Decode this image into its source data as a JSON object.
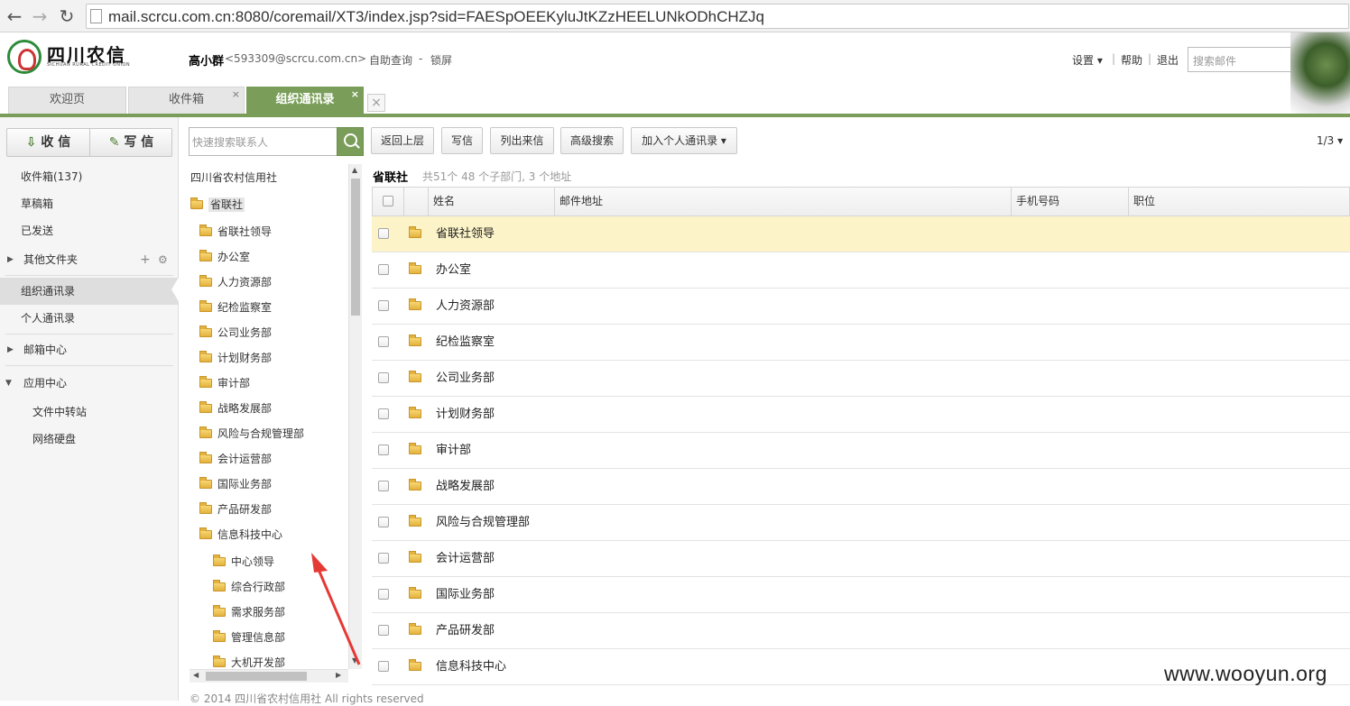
{
  "browser": {
    "url": "mail.scrcu.com.cn:8080/coremail/XT3/index.jsp?sid=FAESpOEEKyluJtKZzHEELUNkODhCHZJq"
  },
  "header": {
    "logo_name": "四川农信",
    "logo_pinyin": "SICHUAN RURAL CREDIT UNION",
    "user_name": "高小群",
    "user_email": "<593309@scrcu.com.cn>",
    "self_query": "自助查询",
    "dash": "-",
    "lock_screen": "锁屏",
    "settings": "设置",
    "settings_caret": "▾",
    "bar1": "|",
    "help": "帮助",
    "bar2": "|",
    "logout": "退出",
    "search_placeholder": "搜索邮件"
  },
  "tabs": [
    {
      "label": "欢迎页"
    },
    {
      "label": "收件箱",
      "close": "×"
    },
    {
      "label": "组织通讯录",
      "close": "×"
    }
  ],
  "tab_close_all": "×",
  "compose": {
    "receive_label": "收 信",
    "write_label": "写 信"
  },
  "nav": {
    "inbox": "收件箱(137)",
    "drafts": "草稿箱",
    "sent": "已发送",
    "other_folders": "其他文件夹",
    "add": "+",
    "gear": "⚙",
    "org_contacts": "组织通讯录",
    "personal_contacts": "个人通讯录",
    "mailbox_center": "邮箱中心",
    "app_center": "应用中心",
    "file_transfer": "文件中转站",
    "net_disk": "网络硬盘"
  },
  "tree": {
    "search_placeholder": "快速搜索联系人",
    "root": "四川省农村信用社",
    "current": "省联社",
    "items": [
      "省联社领导",
      "办公室",
      "人力资源部",
      "纪检监察室",
      "公司业务部",
      "计划财务部",
      "审计部",
      "战略发展部",
      "风险与合规管理部",
      "会计运营部",
      "国际业务部",
      "产品研发部",
      "信息科技中心"
    ],
    "subitems": [
      "中心领导",
      "综合行政部",
      "需求服务部",
      "管理信息部",
      "大机开发部"
    ]
  },
  "toolbar": {
    "back": "返回上层",
    "write": "写信",
    "list_mail": "列出来信",
    "advanced_search": "高级搜索",
    "add_personal": "加入个人通讯录",
    "add_caret": "▾",
    "pager": "1/3",
    "pager_caret": "▾"
  },
  "content": {
    "title": "省联社",
    "subtitle": "共51个 48 个子部门, 3 个地址",
    "columns": {
      "name": "姓名",
      "email": "邮件地址",
      "phone": "手机号码",
      "position": "职位"
    },
    "rows": [
      "省联社领导",
      "办公室",
      "人力资源部",
      "纪检监察室",
      "公司业务部",
      "计划财务部",
      "审计部",
      "战略发展部",
      "风险与合规管理部",
      "会计运营部",
      "国际业务部",
      "产品研发部",
      "信息科技中心"
    ]
  },
  "footer": {
    "copyright": "© 2014 四川省农村信用社  All rights reserved"
  },
  "watermark": "www.wooyun.org",
  "colors": {
    "brand_green": "#7a9e5a",
    "highlight_row": "#fcf3c8",
    "annotation_red": "#e53935"
  }
}
